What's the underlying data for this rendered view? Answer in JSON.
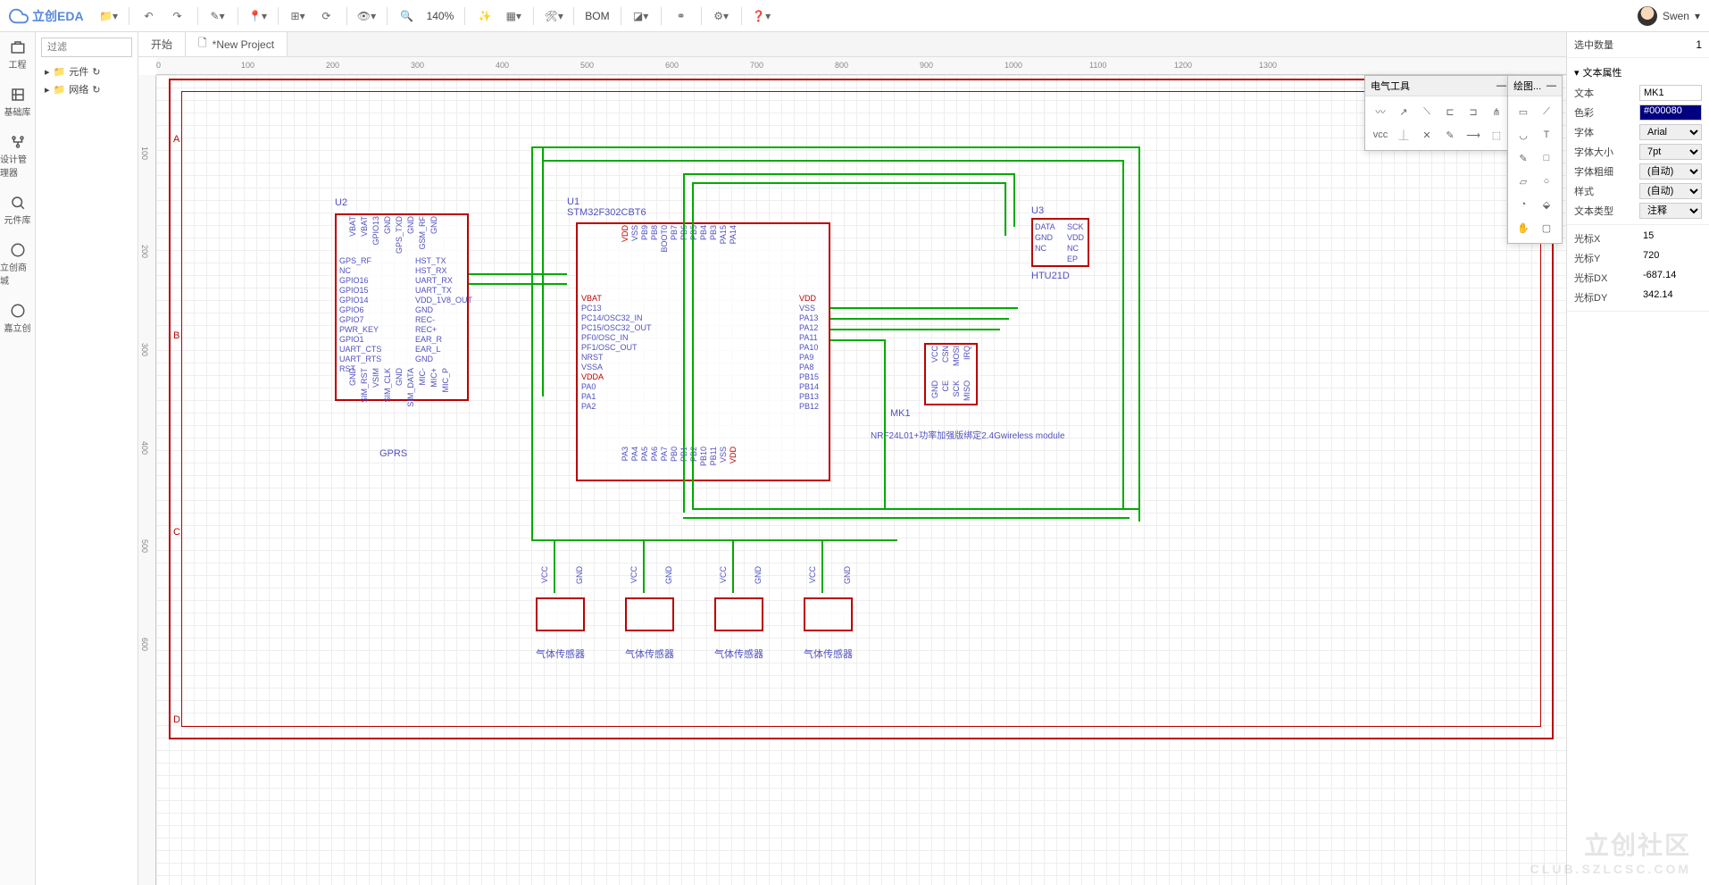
{
  "app": {
    "name": "立创EDA"
  },
  "toolbar": {
    "zoom": "140%",
    "bom_label": "BOM"
  },
  "user": {
    "name": "Swen"
  },
  "leftRail": {
    "items": [
      {
        "label": "工程"
      },
      {
        "label": "基础库"
      },
      {
        "label": "设计管理器"
      },
      {
        "label": "元件库"
      },
      {
        "label": "立创商城"
      },
      {
        "label": "嘉立创"
      }
    ]
  },
  "leftPanel": {
    "filter_placeholder": "过滤",
    "tree": [
      {
        "label": "元件"
      },
      {
        "label": "网络"
      }
    ]
  },
  "tabs": [
    {
      "label": "开始"
    },
    {
      "label": "*New Project"
    }
  ],
  "palettes": {
    "electrical": {
      "title": "电气工具"
    },
    "drawing": {
      "title": "绘图..."
    }
  },
  "rightPanel": {
    "selection_label": "选中数量",
    "selection_count": "1",
    "section_title": "文本属性",
    "props": {
      "text_label": "文本",
      "text_value": "MK1",
      "color_label": "色彩",
      "color_value": "#000080",
      "font_label": "字体",
      "font_value": "Arial",
      "size_label": "字体大小",
      "size_value": "7pt",
      "weight_label": "字体粗细",
      "weight_value": "(自动)",
      "style_label": "样式",
      "style_value": "(自动)",
      "type_label": "文本类型",
      "type_value": "注释"
    },
    "cursor": {
      "x_label": "光标X",
      "x_value": "15",
      "y_label": "光标Y",
      "y_value": "720",
      "dx_label": "光标DX",
      "dx_value": "-687.14",
      "dy_label": "光标DY",
      "dy_value": "342.14"
    }
  },
  "schematic": {
    "u1": {
      "ref": "U1",
      "name": "STM32F302CBT6",
      "left_pins": [
        "VBAT",
        "PC13",
        "PC14/OSC32_IN",
        "PC15/OSC32_OUT",
        "PF0/OSC_IN",
        "PF1/OSC_OUT",
        "NRST",
        "VSSA",
        "VDDA",
        "PA0",
        "PA1",
        "PA2"
      ],
      "right_pins": [
        "VDD",
        "VSS",
        "PA13",
        "PA12",
        "PA11",
        "PA10",
        "PA9",
        "PA8",
        "PB15",
        "PB14",
        "PB13",
        "PB12"
      ],
      "top_pins": [
        "VDD",
        "VSS",
        "PB9",
        "PB8",
        "BOOT0",
        "PB7",
        "PB6",
        "PB5",
        "PB4",
        "PB3",
        "PA15",
        "PA14"
      ],
      "bottom_pins": [
        "PA3",
        "PA4",
        "PA5",
        "PA6",
        "PA7",
        "PB0",
        "PB1",
        "PB2",
        "PB10",
        "PB11",
        "VSS",
        "VDD"
      ]
    },
    "u2": {
      "ref": "U2",
      "name": "GPRS",
      "left_pins": [
        "GPS_RF",
        "NC",
        "GPIO16",
        "GPIO15",
        "GPIO14",
        "GPIO6",
        "GPIO7",
        "PWR_KEY",
        "GPIO1",
        "UART_CTS",
        "UART_RTS",
        "RST"
      ],
      "right_pins": [
        "HST_TX",
        "HST_RX",
        "UART_RX",
        "UART_TX",
        "VDD_1V8_OUT",
        "GND",
        "REC-",
        "REC+",
        "EAR_R",
        "EAR_L",
        "GND"
      ],
      "top_pins": [
        "VBAT",
        "VBAT",
        "GPIO13",
        "GND",
        "GPS_TXD",
        "GND",
        "GSM_RF",
        "GND"
      ],
      "bottom_pins": [
        "GND",
        "SIM_RST",
        "VSIM",
        "SIM_CLK",
        "GND",
        "SIM_DATA",
        "MIC-",
        "MIC+",
        "MIC_P"
      ]
    },
    "u3": {
      "ref": "U3",
      "name": "HTU21D",
      "left_pins": [
        "DATA",
        "GND",
        "NC"
      ],
      "right_pins": [
        "SCK",
        "VDD",
        "NC",
        "EP"
      ]
    },
    "mk1": {
      "ref": "MK1",
      "name": "NRF24L01+功率加强版绑定2.4Gwireless module",
      "top_pins": [
        "VCC",
        "CSN",
        "MOSI",
        "IRQ"
      ],
      "bottom_pins": [
        "GND",
        "CE",
        "SCK",
        "MISO"
      ]
    },
    "sensor_name": "气体传感器",
    "sensor_pins": [
      "VCC",
      "",
      "",
      "GND"
    ]
  },
  "ruler_h": [
    "0",
    "100",
    "200",
    "300",
    "400",
    "500",
    "600",
    "700",
    "800",
    "900",
    "1000",
    "1100",
    "1200",
    "1300"
  ],
  "ruler_v": [
    "100",
    "200",
    "300",
    "400",
    "500",
    "600"
  ],
  "zones": [
    "A",
    "B",
    "C",
    "D"
  ],
  "watermark": {
    "line1": "立创社区",
    "line2": "CLUB.SZLCSC.COM"
  }
}
